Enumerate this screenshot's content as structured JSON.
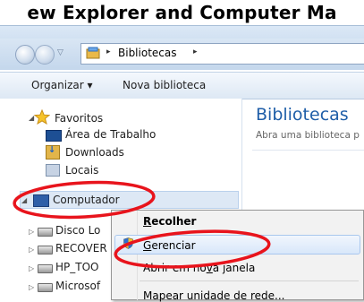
{
  "page": {
    "heading": "ew Explorer and Computer Ma"
  },
  "address_bar": {
    "crumb": "Bibliotecas",
    "sep1": "▸",
    "sep2": "▸"
  },
  "command_bar": {
    "organizar": "Organizar ▾",
    "nova": "Nova biblioteca"
  },
  "sidebar": {
    "favoritos": "Favoritos",
    "items": [
      {
        "label": "Área de Trabalho",
        "icon": "desktop-icon"
      },
      {
        "label": "Downloads",
        "icon": "downloads-folder-icon"
      },
      {
        "label": "Locais",
        "icon": "recent-places-icon"
      }
    ],
    "computer": "Computador",
    "drives": [
      {
        "label": "Disco Lo",
        "icon": "os-drive-icon"
      },
      {
        "label": "RECOVER",
        "icon": "drive-icon"
      },
      {
        "label": "HP_TOO",
        "icon": "drive-icon"
      },
      {
        "label": "Microsof",
        "icon": "drive-icon"
      }
    ]
  },
  "main": {
    "title": "Bibliotecas",
    "subtitle": "Abra uma biblioteca p"
  },
  "context_menu": {
    "items": [
      {
        "pre": "",
        "u": "R",
        "post": "ecolher"
      },
      {
        "pre": "",
        "u": "G",
        "post": "erenciar"
      },
      {
        "pre": "Abrir em no",
        "u": "v",
        "post": "a janela"
      },
      {
        "pre": "Mapear unidade de rede...",
        "u": "",
        "post": ""
      }
    ]
  },
  "colors": {
    "annotation": "#e8141c",
    "accent": "#1f5ea8"
  }
}
